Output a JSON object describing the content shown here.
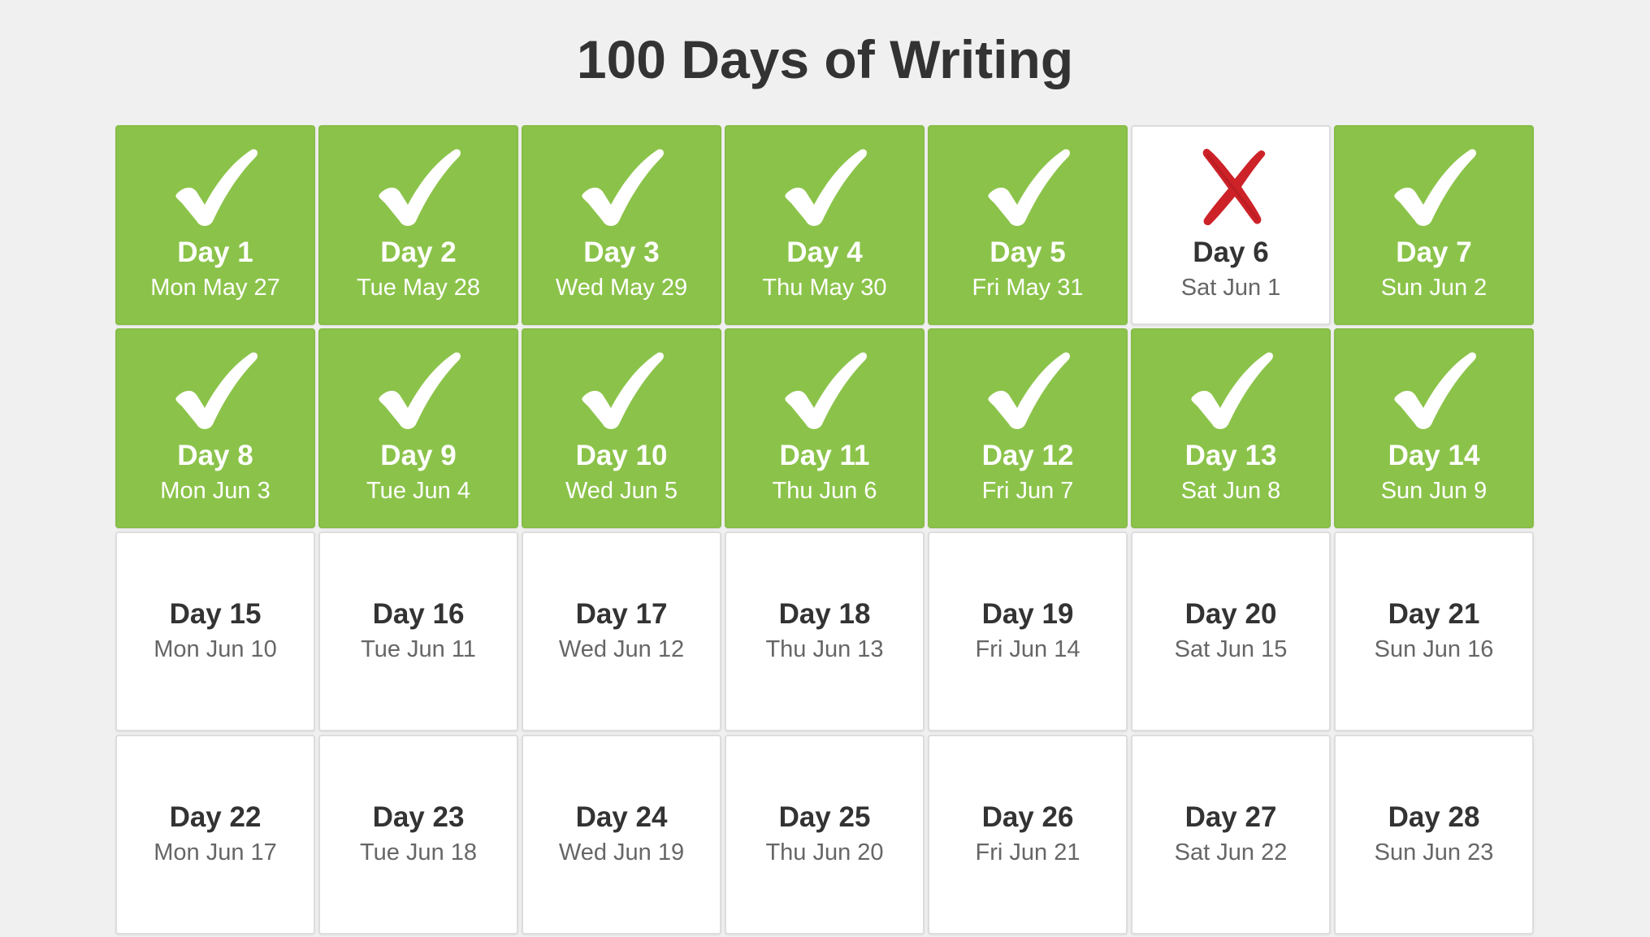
{
  "page": {
    "title": "100 Days of Writing"
  },
  "colors": {
    "background": "#f0f0f0",
    "done": "#8bc34a",
    "pending": "#ffffff",
    "missed_mark": "#cc2228",
    "text_dark": "#333333",
    "text_muted": "#666666"
  },
  "days": [
    {
      "label": "Day 1",
      "date": "Mon May 27",
      "status": "done"
    },
    {
      "label": "Day 2",
      "date": "Tue May 28",
      "status": "done"
    },
    {
      "label": "Day 3",
      "date": "Wed May 29",
      "status": "done"
    },
    {
      "label": "Day 4",
      "date": "Thu May 30",
      "status": "done"
    },
    {
      "label": "Day 5",
      "date": "Fri May 31",
      "status": "done"
    },
    {
      "label": "Day 6",
      "date": "Sat Jun 1",
      "status": "missed"
    },
    {
      "label": "Day 7",
      "date": "Sun Jun 2",
      "status": "done"
    },
    {
      "label": "Day 8",
      "date": "Mon Jun 3",
      "status": "done"
    },
    {
      "label": "Day 9",
      "date": "Tue Jun 4",
      "status": "done"
    },
    {
      "label": "Day 10",
      "date": "Wed Jun 5",
      "status": "done"
    },
    {
      "label": "Day 11",
      "date": "Thu Jun 6",
      "status": "done"
    },
    {
      "label": "Day 12",
      "date": "Fri Jun 7",
      "status": "done"
    },
    {
      "label": "Day 13",
      "date": "Sat Jun 8",
      "status": "done"
    },
    {
      "label": "Day 14",
      "date": "Sun Jun 9",
      "status": "done"
    },
    {
      "label": "Day 15",
      "date": "Mon Jun 10",
      "status": "pending"
    },
    {
      "label": "Day 16",
      "date": "Tue Jun 11",
      "status": "pending"
    },
    {
      "label": "Day 17",
      "date": "Wed Jun 12",
      "status": "pending"
    },
    {
      "label": "Day 18",
      "date": "Thu Jun 13",
      "status": "pending"
    },
    {
      "label": "Day 19",
      "date": "Fri Jun 14",
      "status": "pending"
    },
    {
      "label": "Day 20",
      "date": "Sat Jun 15",
      "status": "pending"
    },
    {
      "label": "Day 21",
      "date": "Sun Jun 16",
      "status": "pending"
    },
    {
      "label": "Day 22",
      "date": "Mon Jun 17",
      "status": "pending"
    },
    {
      "label": "Day 23",
      "date": "Tue Jun 18",
      "status": "pending"
    },
    {
      "label": "Day 24",
      "date": "Wed Jun 19",
      "status": "pending"
    },
    {
      "label": "Day 25",
      "date": "Thu Jun 20",
      "status": "pending"
    },
    {
      "label": "Day 26",
      "date": "Fri Jun 21",
      "status": "pending"
    },
    {
      "label": "Day 27",
      "date": "Sat Jun 22",
      "status": "pending"
    },
    {
      "label": "Day 28",
      "date": "Sun Jun 23",
      "status": "pending"
    }
  ]
}
